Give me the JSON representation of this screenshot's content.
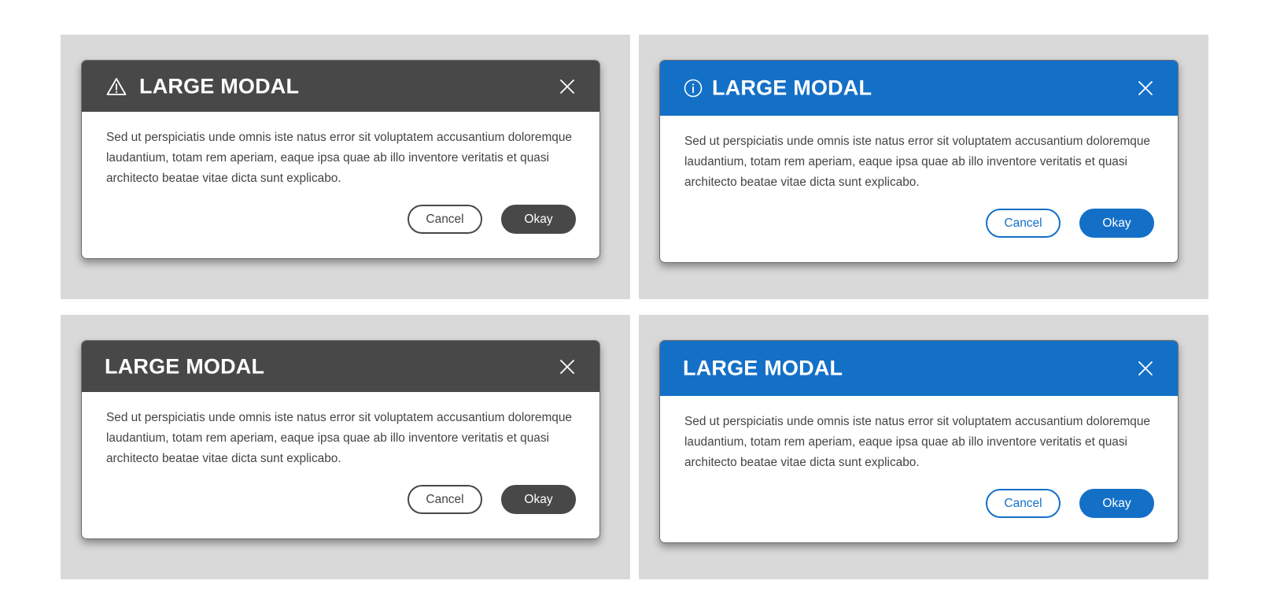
{
  "modals": [
    {
      "variant": "dark",
      "header_icon": "warning-icon",
      "title": "LARGE MODAL",
      "close_icon": "close-icon",
      "body": "Sed ut perspiciatis unde omnis iste natus error sit voluptatem accusantium doloremque laudantium, totam rem aperiam, eaque ipsa quae ab illo inventore veritatis et quasi architecto beatae vitae dicta sunt explicabo.",
      "cancel_label": "Cancel",
      "okay_label": "Okay"
    },
    {
      "variant": "blue",
      "header_icon": "info-icon",
      "title": "LARGE MODAL",
      "close_icon": "close-icon",
      "body": "Sed ut perspiciatis unde omnis iste natus error sit voluptatem accusantium doloremque laudantium, totam rem aperiam, eaque ipsa quae ab illo inventore veritatis et quasi architecto beatae vitae dicta sunt explicabo.",
      "cancel_label": "Cancel",
      "okay_label": "Okay"
    },
    {
      "variant": "dark",
      "header_icon": "",
      "title": "LARGE MODAL",
      "close_icon": "close-icon",
      "body": "Sed ut perspiciatis unde omnis iste natus error sit voluptatem accusantium doloremque laudantium, totam rem aperiam, eaque ipsa quae ab illo inventore veritatis et quasi architecto beatae vitae dicta sunt explicabo.",
      "cancel_label": "Cancel",
      "okay_label": "Okay"
    },
    {
      "variant": "blue",
      "header_icon": "",
      "title": "LARGE MODAL",
      "close_icon": "close-icon",
      "body": "Sed ut perspiciatis unde omnis iste natus error sit voluptatem accusantium doloremque laudantium, totam rem aperiam, eaque ipsa quae ab illo inventore veritatis et quasi architecto beatae vitae dicta sunt explicabo.",
      "cancel_label": "Cancel",
      "okay_label": "Okay"
    }
  ],
  "colors": {
    "dark_header": "#484848",
    "brand_blue": "#1470c7",
    "panel_background": "#d9d9d9",
    "body_text": "#444444"
  }
}
